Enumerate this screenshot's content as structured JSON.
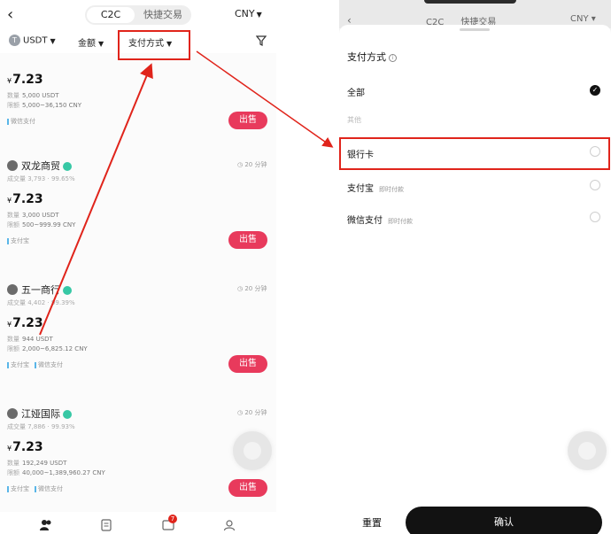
{
  "left": {
    "topbar": {
      "tab_active": "C2C",
      "tab_inactive": "快捷交易",
      "currency": "CNY"
    },
    "filters": {
      "coin": "USDT",
      "amount": "金额",
      "payment": "支付方式",
      "coin_icon": "T"
    },
    "ads": [
      {
        "name": "",
        "time": "",
        "stats": "",
        "price": "7.23",
        "qty_label": "数量",
        "qty": "5,000 USDT",
        "limit_label": "限额",
        "limit": "5,000~36,150 CNY",
        "pays": [
          "微信支付"
        ],
        "action": "出售"
      },
      {
        "name": "双龙商贸",
        "time": "20 分钟",
        "stats": "成交量 3,793 · 99.65%",
        "price": "7.23",
        "qty_label": "数量",
        "qty": "3,000 USDT",
        "limit_label": "限额",
        "limit": "500~999.99 CNY",
        "pays": [
          "支付宝"
        ],
        "action": "出售"
      },
      {
        "name": "五一商行",
        "time": "20 分钟",
        "stats": "成交量 4,402 · 99.39%",
        "price": "7.23",
        "qty_label": "数量",
        "qty": "944 USDT",
        "limit_label": "限额",
        "limit": "2,000~6,825.12 CNY",
        "pays": [
          "支付宝",
          "微信支付"
        ],
        "action": "出售"
      },
      {
        "name": "江娅国际",
        "time": "20 分钟",
        "stats": "成交量 7,886 · 99.93%",
        "price": "7.23",
        "qty_label": "数量",
        "qty": "192,249 USDT",
        "limit_label": "限额",
        "limit": "40,000~1,389,960.27 CNY",
        "pays": [
          "支付宝",
          "微信支付"
        ],
        "action": "出售"
      }
    ],
    "currency_symbol": "¥",
    "nav_badge": "7"
  },
  "right": {
    "bg": {
      "tab_active": "C2C",
      "tab_inactive": "快捷交易",
      "currency": "CNY"
    },
    "sheet_title": "支付方式",
    "options": [
      {
        "label": "全部",
        "sub": "",
        "state": "checked"
      },
      {
        "label": "其他",
        "sub": "",
        "state": "muted"
      },
      {
        "label": "银行卡",
        "sub": "",
        "state": "unchecked"
      },
      {
        "label": "支付宝",
        "sub": "即时付款",
        "state": "unchecked"
      },
      {
        "label": "微信支付",
        "sub": "即时付款",
        "state": "unchecked"
      }
    ],
    "reset_label": "重置",
    "confirm_label": "确认"
  },
  "colors": {
    "highlight": "#e0241b",
    "sell": "#e83a5c",
    "verify": "#37c8a5"
  }
}
